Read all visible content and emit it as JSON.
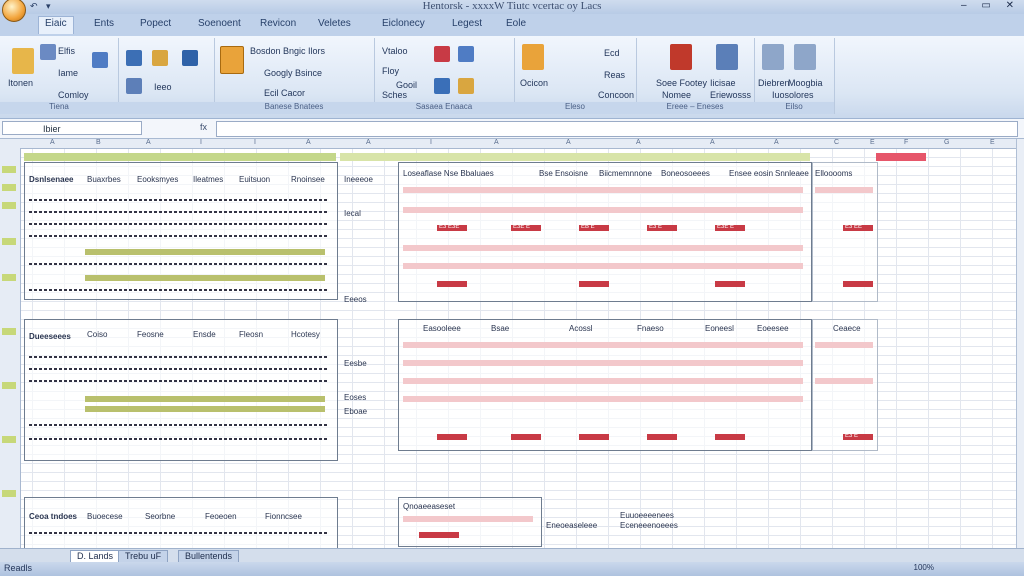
{
  "window": {
    "title": "Hentorsk - xxxxW Tiutc vcertac oy Lacs",
    "controls": "– ▭ ✕"
  },
  "qat": "↶ ▾",
  "tabs": [
    "Eiaic",
    "Ents",
    "Popect",
    "Soenoent",
    "Revicon",
    "Veletes",
    "Eiclonecy",
    "Legest",
    "Eole"
  ],
  "ribbon": {
    "groups": [
      {
        "label": "Tiena",
        "items": [
          "Itonen",
          "Elfis",
          "Iame",
          "Comloy"
        ]
      },
      {
        "label": "",
        "items": [
          "Ieeo"
        ]
      },
      {
        "label": "Banese Bnatees",
        "items": [
          "Bosdon Bngic Ilors",
          "Googly Bsince",
          "Ecil Cacor"
        ]
      },
      {
        "label": "Sasaea Enaaca",
        "items": [
          "Vtaloo",
          "Floy",
          "Gooil",
          "Sches"
        ]
      },
      {
        "label": "Eleso",
        "items": [
          "Ocicon",
          "Ecd",
          "Reas",
          "Concoon"
        ]
      },
      {
        "label": "Ereee – Eneses",
        "items": [
          "Soee Footey",
          "Nomee",
          "Iicisae",
          "Eriewosss"
        ]
      },
      {
        "label": "Eilso",
        "items": [
          "Diebren",
          "Moogbia",
          "Iuosolores"
        ]
      }
    ]
  },
  "formula": {
    "namebox": "Ibier",
    "fx": "fx"
  },
  "grid": {
    "columns": [
      "A",
      "B",
      "A",
      "I",
      "I",
      "A",
      "A",
      "I",
      "A",
      "A",
      "A",
      "A",
      "A",
      "C",
      "E",
      "F",
      "G",
      "E"
    ],
    "blocks": {
      "left_top": {
        "headers": [
          "Dsnlsenaee",
          "Buaxrbes",
          "Eooksmyes",
          "Ileatmes",
          "Euitsuon",
          "Rnoinsee"
        ]
      },
      "left_mid": {
        "headers": [
          "Dueeseees",
          "Coiso",
          "Feosne",
          "Ensde",
          "Fleosn",
          "Hcotesy"
        ]
      },
      "left_bot": {
        "headers": [
          "Ceoa tndoes",
          "Buoecese",
          "Seorbne",
          "Feoeoen",
          "Fionncsee"
        ]
      },
      "center_labels": [
        "Ineeeoe",
        "Iecal",
        "Eeeos",
        "Eesbe",
        "Eoses",
        "Eboae"
      ],
      "right_top_headers": [
        "Loseaflase Nse Bbaluaes",
        "Bse Ensoisne",
        "Biicmemnnone",
        "Boneosoeees",
        "Ensee eosin",
        "Snnleaee",
        "Ellooooms"
      ],
      "right_mid_headers": [
        "Easooleee",
        "Bsae",
        "Acossl",
        "Fnaeso",
        "Eoneesl",
        "Eoeesee",
        "Ceaece"
      ],
      "bottom_center": [
        "Qnoaeeaseset",
        "Eneoeaseleee",
        "Euuoeeeenees",
        "Eceneeenoeees"
      ],
      "red_values": [
        "E3 E3E",
        "E3E E",
        "EB E",
        "E3 E",
        "E3E E",
        "E3 EE",
        "E3 E"
      ]
    }
  },
  "sheets": [
    "D. Lands",
    "Trebu uF",
    "Bullentends"
  ],
  "status": {
    "left": "Readls",
    "zoom": "100%"
  }
}
